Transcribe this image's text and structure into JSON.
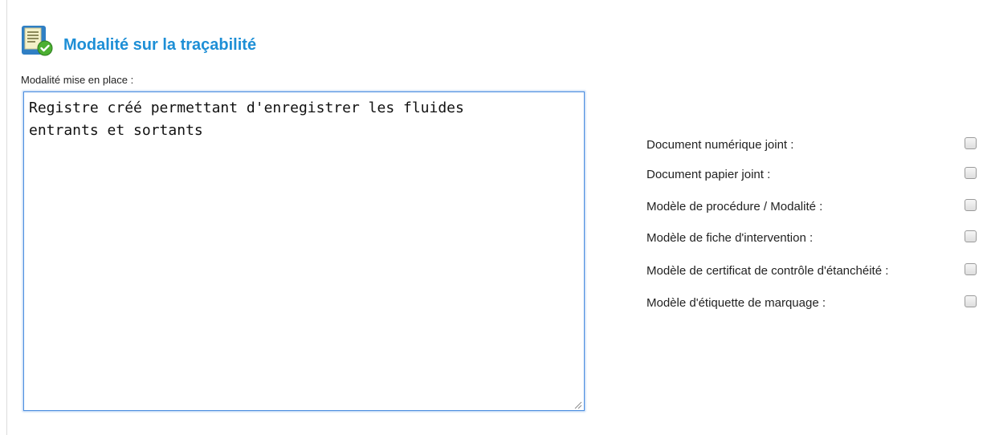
{
  "section": {
    "title": "Modalité sur la traçabilité",
    "icon": "document-check-icon"
  },
  "modalite": {
    "label": "Modalité mise en place :",
    "value": "Registre créé permettant d'enregistrer les fluides\nentrants et sortants "
  },
  "options": [
    {
      "label": "Document numérique joint :",
      "checked": false
    },
    {
      "label": "Document papier joint :",
      "checked": false
    },
    {
      "label": "Modèle de procédure / Modalité :",
      "checked": false
    },
    {
      "label": "Modèle de fiche d'intervention :",
      "checked": false
    },
    {
      "label": "Modèle de certificat de contrôle d'étanchéité :",
      "checked": false
    },
    {
      "label": "Modèle d'étiquette de marquage :",
      "checked": false
    }
  ],
  "colors": {
    "title": "#1e8fd6",
    "focus_border": "#4d8fe0"
  }
}
